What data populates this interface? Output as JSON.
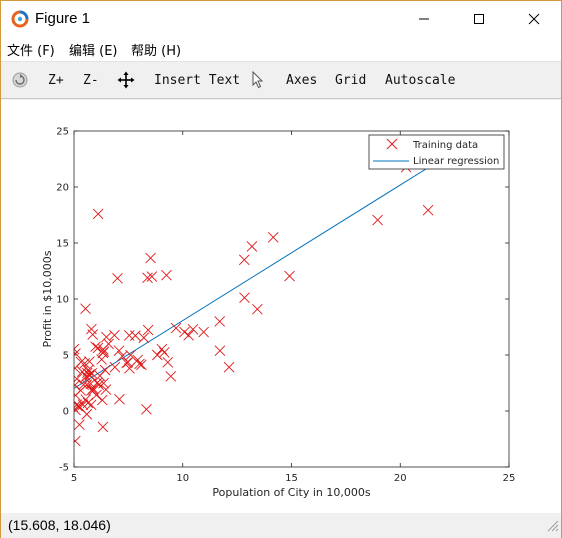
{
  "window": {
    "title": "Figure 1"
  },
  "menu": [
    {
      "label": "文件 (F)"
    },
    {
      "label": "编辑 (E)"
    },
    {
      "label": "帮助 (H)"
    }
  ],
  "toolbar": {
    "zoom_in": "Z+",
    "zoom_out": "Z-",
    "insert_text": "Insert Text",
    "axes": "Axes",
    "grid": "Grid",
    "autoscale": "Autoscale"
  },
  "status": {
    "coords": "(15.608, 18.046)"
  },
  "colors": {
    "training": "#e01818",
    "regression": "#0072bd",
    "window_border": "#d29a3a"
  },
  "icons": [
    "octave-logo-icon",
    "minimize-icon",
    "maximize-icon",
    "close-icon",
    "rotate-icon",
    "pan-icon",
    "select-arrow-icon",
    "resize-grip-icon"
  ],
  "chart_data": {
    "type": "scatter",
    "title": "",
    "xlabel": "Population of City in 10,000s",
    "ylabel": "Profit in $10,000s",
    "xlim": [
      5,
      25
    ],
    "ylim": [
      -5,
      25
    ],
    "xticks": [
      "5",
      "10",
      "15",
      "20",
      "25"
    ],
    "yticks": [
      "-5",
      "0",
      "5",
      "10",
      "15",
      "20",
      "25"
    ],
    "legend_position": "top-right",
    "series": [
      {
        "name": "Training data",
        "kind": "scatter",
        "marker": "x",
        "color": "#e01818",
        "points": [
          [
            6.11,
            17.59
          ],
          [
            5.53,
            9.13
          ],
          [
            8.52,
            13.66
          ],
          [
            7.0,
            11.85
          ],
          [
            5.86,
            6.82
          ],
          [
            8.38,
            11.89
          ],
          [
            7.48,
            4.35
          ],
          [
            8.58,
            12.0
          ],
          [
            6.49,
            6.6
          ],
          [
            5.05,
            3.82
          ],
          [
            5.71,
            3.25
          ],
          [
            14.16,
            15.51
          ],
          [
            5.73,
            3.16
          ],
          [
            8.41,
            7.23
          ],
          [
            5.64,
            0.72
          ],
          [
            5.38,
            3.51
          ],
          [
            6.37,
            5.3
          ],
          [
            5.13,
            0.56
          ],
          [
            6.43,
            3.65
          ],
          [
            7.07,
            5.39
          ],
          [
            6.19,
            3.14
          ],
          [
            20.27,
            21.77
          ],
          [
            5.49,
            4.26
          ],
          [
            6.33,
            5.19
          ],
          [
            5.56,
            3.08
          ],
          [
            18.95,
            22.64
          ],
          [
            12.83,
            13.5
          ],
          [
            10.96,
            7.05
          ],
          [
            13.18,
            14.69
          ],
          [
            22.2,
            24.15
          ],
          [
            5.25,
            -1.22
          ],
          [
            6.59,
            5.99
          ],
          [
            9.25,
            12.13
          ],
          [
            5.89,
            1.85
          ],
          [
            8.21,
            6.54
          ],
          [
            7.93,
            4.56
          ],
          [
            8.1,
            4.12
          ],
          [
            5.61,
            3.39
          ],
          [
            12.84,
            10.12
          ],
          [
            6.35,
            5.5
          ],
          [
            5.41,
            0.56
          ],
          [
            6.88,
            3.91
          ],
          [
            11.71,
            5.39
          ],
          [
            5.77,
            2.44
          ],
          [
            7.82,
            6.73
          ],
          [
            7.09,
            1.05
          ],
          [
            5.07,
            5.13
          ],
          [
            5.8,
            1.84
          ],
          [
            11.7,
            8.0
          ],
          [
            5.54,
            1.02
          ],
          [
            7.54,
            6.75
          ],
          [
            5.31,
            1.84
          ],
          [
            7.42,
            4.29
          ],
          [
            7.6,
            4.99
          ],
          [
            6.03,
            1.42
          ],
          [
            6.33,
            -1.42
          ],
          [
            6.36,
            2.48
          ],
          [
            6.27,
            4.6
          ],
          [
            5.64,
            3.62
          ],
          [
            9.31,
            4.35
          ],
          [
            9.45,
            3.1
          ],
          [
            8.83,
            5.0
          ],
          [
            5.17,
            0.43
          ],
          [
            21.28,
            17.93
          ],
          [
            14.91,
            12.05
          ],
          [
            18.96,
            17.05
          ],
          [
            7.22,
            4.89
          ],
          [
            5.99,
            5.74
          ],
          [
            12.13,
            3.91
          ],
          [
            5.44,
            2.35
          ],
          [
            5.13,
            2.87
          ],
          [
            5.06,
            -2.68
          ],
          [
            5.71,
            4.41
          ],
          [
            6.3,
            0.98
          ],
          [
            6.47,
            1.91
          ],
          [
            5.88,
            2.0
          ],
          [
            9.69,
            7.41
          ],
          [
            5.07,
            0.09
          ],
          [
            7.55,
            3.81
          ],
          [
            6.14,
            2.33
          ],
          [
            5.59,
            -0.29
          ],
          [
            5.0,
            5.53
          ],
          [
            13.43,
            9.09
          ],
          [
            10.08,
            7.05
          ],
          [
            5.25,
            0.4
          ],
          [
            5.79,
            0.55
          ],
          [
            8.33,
            0.15
          ],
          [
            9.15,
            5.23
          ],
          [
            10.47,
            7.29
          ],
          [
            6.08,
            2.54
          ],
          [
            5.32,
            4.38
          ],
          [
            5.07,
            1.4
          ],
          [
            9.04,
            5.52
          ],
          [
            5.04,
            2.31
          ],
          [
            6.1,
            5.63
          ],
          [
            5.59,
            2.36
          ],
          [
            8.01,
            4.2
          ],
          [
            5.8,
            7.32
          ],
          [
            6.86,
            6.77
          ],
          [
            5.82,
            3.37
          ],
          [
            10.27,
            6.76
          ]
        ]
      },
      {
        "name": "Linear regression",
        "kind": "line",
        "color": "#0072bd",
        "points": [
          [
            5.0,
            2.02
          ],
          [
            22.0,
            22.6
          ]
        ]
      }
    ]
  }
}
